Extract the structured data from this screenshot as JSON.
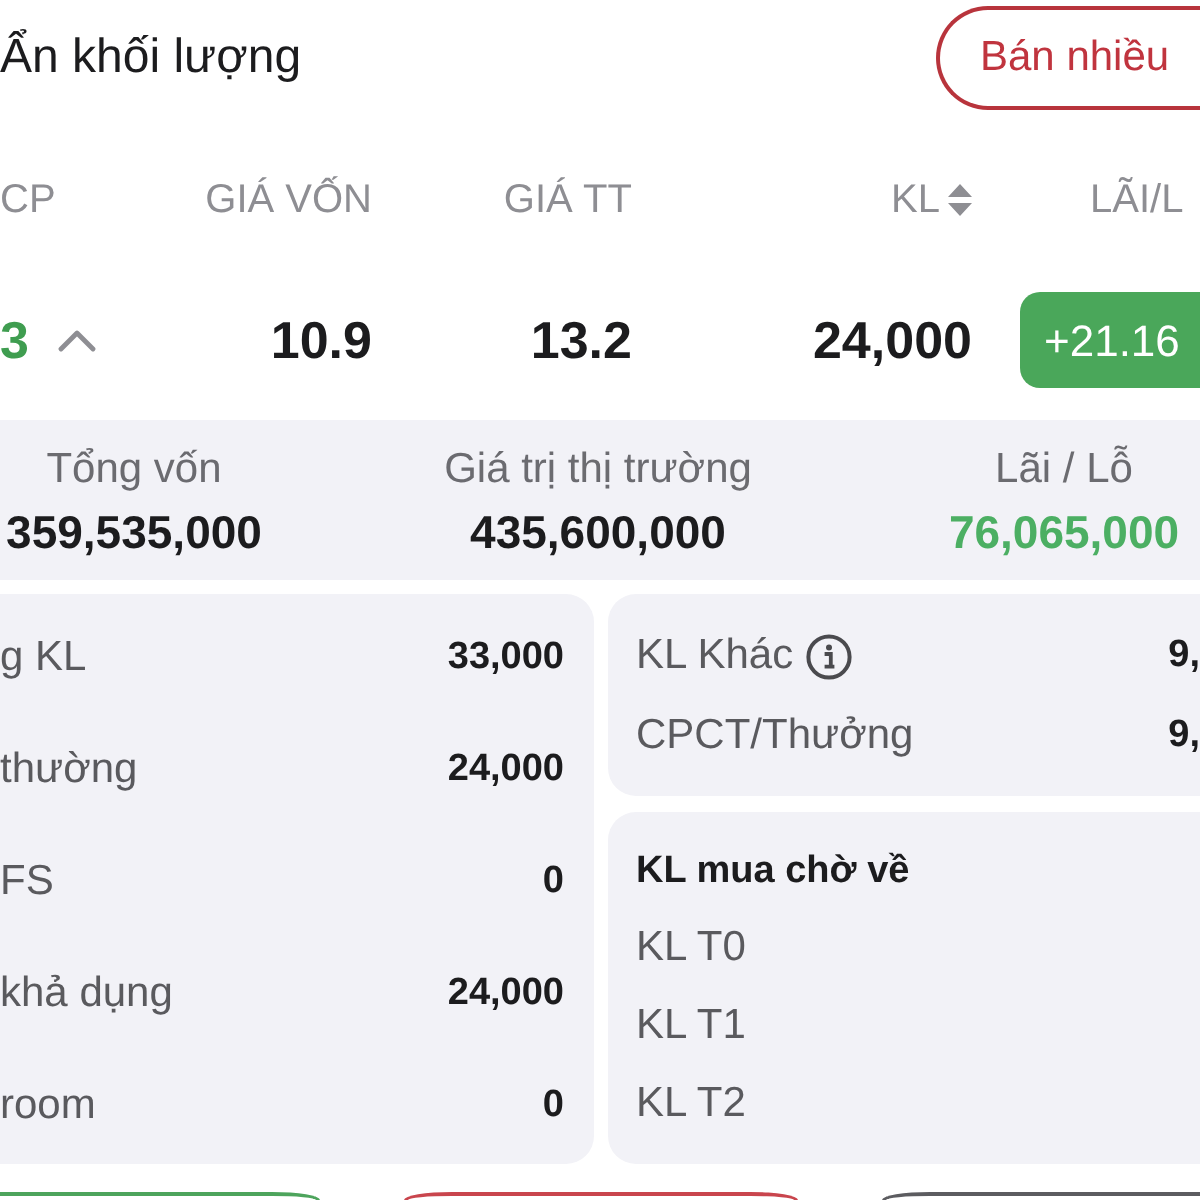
{
  "toolbar": {
    "hide_volume": "Ẩn khối lượng",
    "sell_many_button": "Bán nhiều"
  },
  "table": {
    "columns": [
      {
        "label": "CP",
        "sortable": false
      },
      {
        "label": "GIÁ VỐN",
        "sortable": false
      },
      {
        "label": "GIÁ TT",
        "sortable": false
      },
      {
        "label": "KL",
        "sortable": true
      },
      {
        "label": "LÃI/L",
        "sortable": false
      }
    ],
    "rows": [
      {
        "ticker": "3",
        "expanded": true,
        "cost_price": "10.9",
        "market_price": "13.2",
        "volume": "24,000",
        "profit": "+21.16",
        "gain": true
      }
    ]
  },
  "summary": [
    {
      "label": "Tổng vốn",
      "value": "359,535,000",
      "gain": false
    },
    {
      "label": "Giá trị thị trường",
      "value": "435,600,000",
      "gain": false
    },
    {
      "label": "Lãi / Lỗ",
      "value": "76,065,000",
      "gain": true
    }
  ],
  "volume_details": [
    {
      "label": "g KL",
      "value": "33,000"
    },
    {
      "label": "thường",
      "value": "24,000"
    },
    {
      "label": "FS",
      "value": "0"
    },
    {
      "label": "khả dụng",
      "value": "24,000"
    },
    {
      "label": "room",
      "value": "0"
    }
  ],
  "other_volume": [
    {
      "label": "KL Khác",
      "value": "9,",
      "info": true
    },
    {
      "label": "CPCT/Thưởng",
      "value": "9,",
      "info": false
    }
  ],
  "pending_buy": {
    "title": "KL mua chờ về",
    "rows": [
      {
        "label": "KL T0"
      },
      {
        "label": "KL T1"
      },
      {
        "label": "KL T2"
      }
    ]
  },
  "bottom_buttons": [
    {
      "color": "#4da45c"
    },
    {
      "color": "#c9454d"
    },
    {
      "color": "#5c5c60"
    }
  ]
}
